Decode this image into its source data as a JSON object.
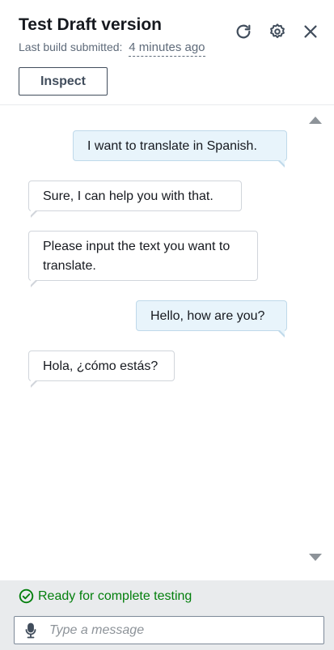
{
  "header": {
    "title": "Test Draft version",
    "subtitle_label": "Last build submitted:",
    "subtitle_time": "4 minutes ago",
    "inspect_label": "Inspect",
    "icons": [
      "refresh-icon",
      "settings-icon",
      "close-icon"
    ]
  },
  "messages": [
    {
      "role": "user",
      "text": "I want to translate in Spanish."
    },
    {
      "role": "bot",
      "text": "Sure, I can help you with that."
    },
    {
      "role": "bot",
      "text": "Please input the text you want to translate."
    },
    {
      "role": "user",
      "text": "Hello, how are you?"
    },
    {
      "role": "bot",
      "text": "Hola, ¿cómo estás?"
    }
  ],
  "footer": {
    "status_text": "Ready for complete testing",
    "status_color": "#037f0c",
    "input_placeholder": "Type a message",
    "input_value": ""
  },
  "colors": {
    "user_bubble": "#e8f4fb",
    "bot_bubble": "#ffffff",
    "footer_bg": "#e9ebed"
  }
}
